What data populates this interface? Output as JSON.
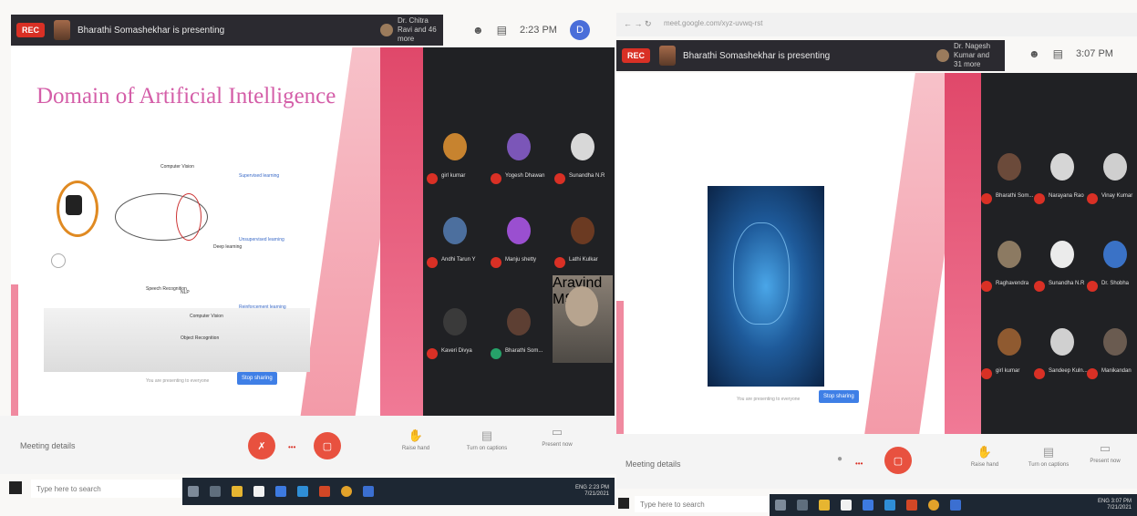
{
  "left": {
    "rec_label": "REC",
    "presenter_text": "Bharathi Somashekhar is presenting",
    "viewer_text": "Dr. Chitra Ravi and 46 more",
    "clock": "2:23 PM",
    "avatar_letter": "D",
    "slide": {
      "title": "Domain of Artificial Intelligence",
      "diagram_nodes": [
        "Computer Vision",
        "Supervised learning",
        "Unsupervised learning",
        "Reinforcement learning",
        "Deep learning",
        "NLP",
        "Speech Recognition",
        "Object Recognition",
        "Computer Vision"
      ]
    },
    "gallery": [
      {
        "name": "girl kumar",
        "color": "#c7832f"
      },
      {
        "name": "Yogesh Dhawan",
        "color": "#7b56b8"
      },
      {
        "name": "Sunandha N.R",
        "color": "#d8d8d8"
      },
      {
        "name": "Andhi Tarun Y",
        "color": "#4c6f9e"
      },
      {
        "name": "Manju shetty",
        "color": "#9a4fd0"
      },
      {
        "name": "Lathi Kulkar",
        "color": "#6b3a22"
      },
      {
        "name": "Kaveri Divya",
        "color": "#3a3a3a"
      },
      {
        "name": "Bharathi Som...",
        "color": "#5d3f33"
      },
      {
        "name": "Aravind MS",
        "color": "#7a7068"
      }
    ],
    "share_note": "You are presenting to everyone",
    "stop_label": "Stop sharing",
    "meeting_details": "Meeting details",
    "ctrl_mic": "Mic",
    "ctrl_cam": "Cam",
    "tools": [
      "Raise hand",
      "Turn on captions",
      "Present now"
    ],
    "search_placeholder": "Type here to search",
    "tb_time": "2:23 PM",
    "tb_date": "7/21/2021",
    "tb_lang": "ENG"
  },
  "right": {
    "url": "meet.google.com/xyz-uvwq-rst",
    "rec_label": "REC",
    "presenter_text": "Bharathi Somashekhar is presenting",
    "viewer_text": "Dr. Nagesh Kumar and 31 more",
    "clock": "3:07 PM",
    "share_note": "You are presenting to everyone",
    "stop_label": "Stop sharing",
    "meeting_details": "Meeting details",
    "ctrl_cam": "Cam",
    "gallery": [
      {
        "name": "Bharathi Som...",
        "color": "#6b4a3a"
      },
      {
        "name": "Narayana Rao",
        "color": "#d6d6d6"
      },
      {
        "name": "Vinay Kumar",
        "color": "#cfcfcf"
      },
      {
        "name": "Raghavendra",
        "color": "#8c7a62"
      },
      {
        "name": "Sunandha N.R",
        "color": "#ebebeb"
      },
      {
        "name": "Dr. Shobha",
        "color": "#3a72c6"
      },
      {
        "name": "girl kumar",
        "color": "#8f5a30"
      },
      {
        "name": "Sandeep Kuln...",
        "color": "#d0d0d0"
      },
      {
        "name": "Manikandan",
        "color": "#6a5b50"
      }
    ],
    "tools": [
      "Raise hand",
      "Turn on captions",
      "Present now"
    ],
    "search_placeholder": "Type here to search",
    "tb_time": "3:07 PM",
    "tb_date": "7/21/2021",
    "tb_lang": "ENG"
  }
}
